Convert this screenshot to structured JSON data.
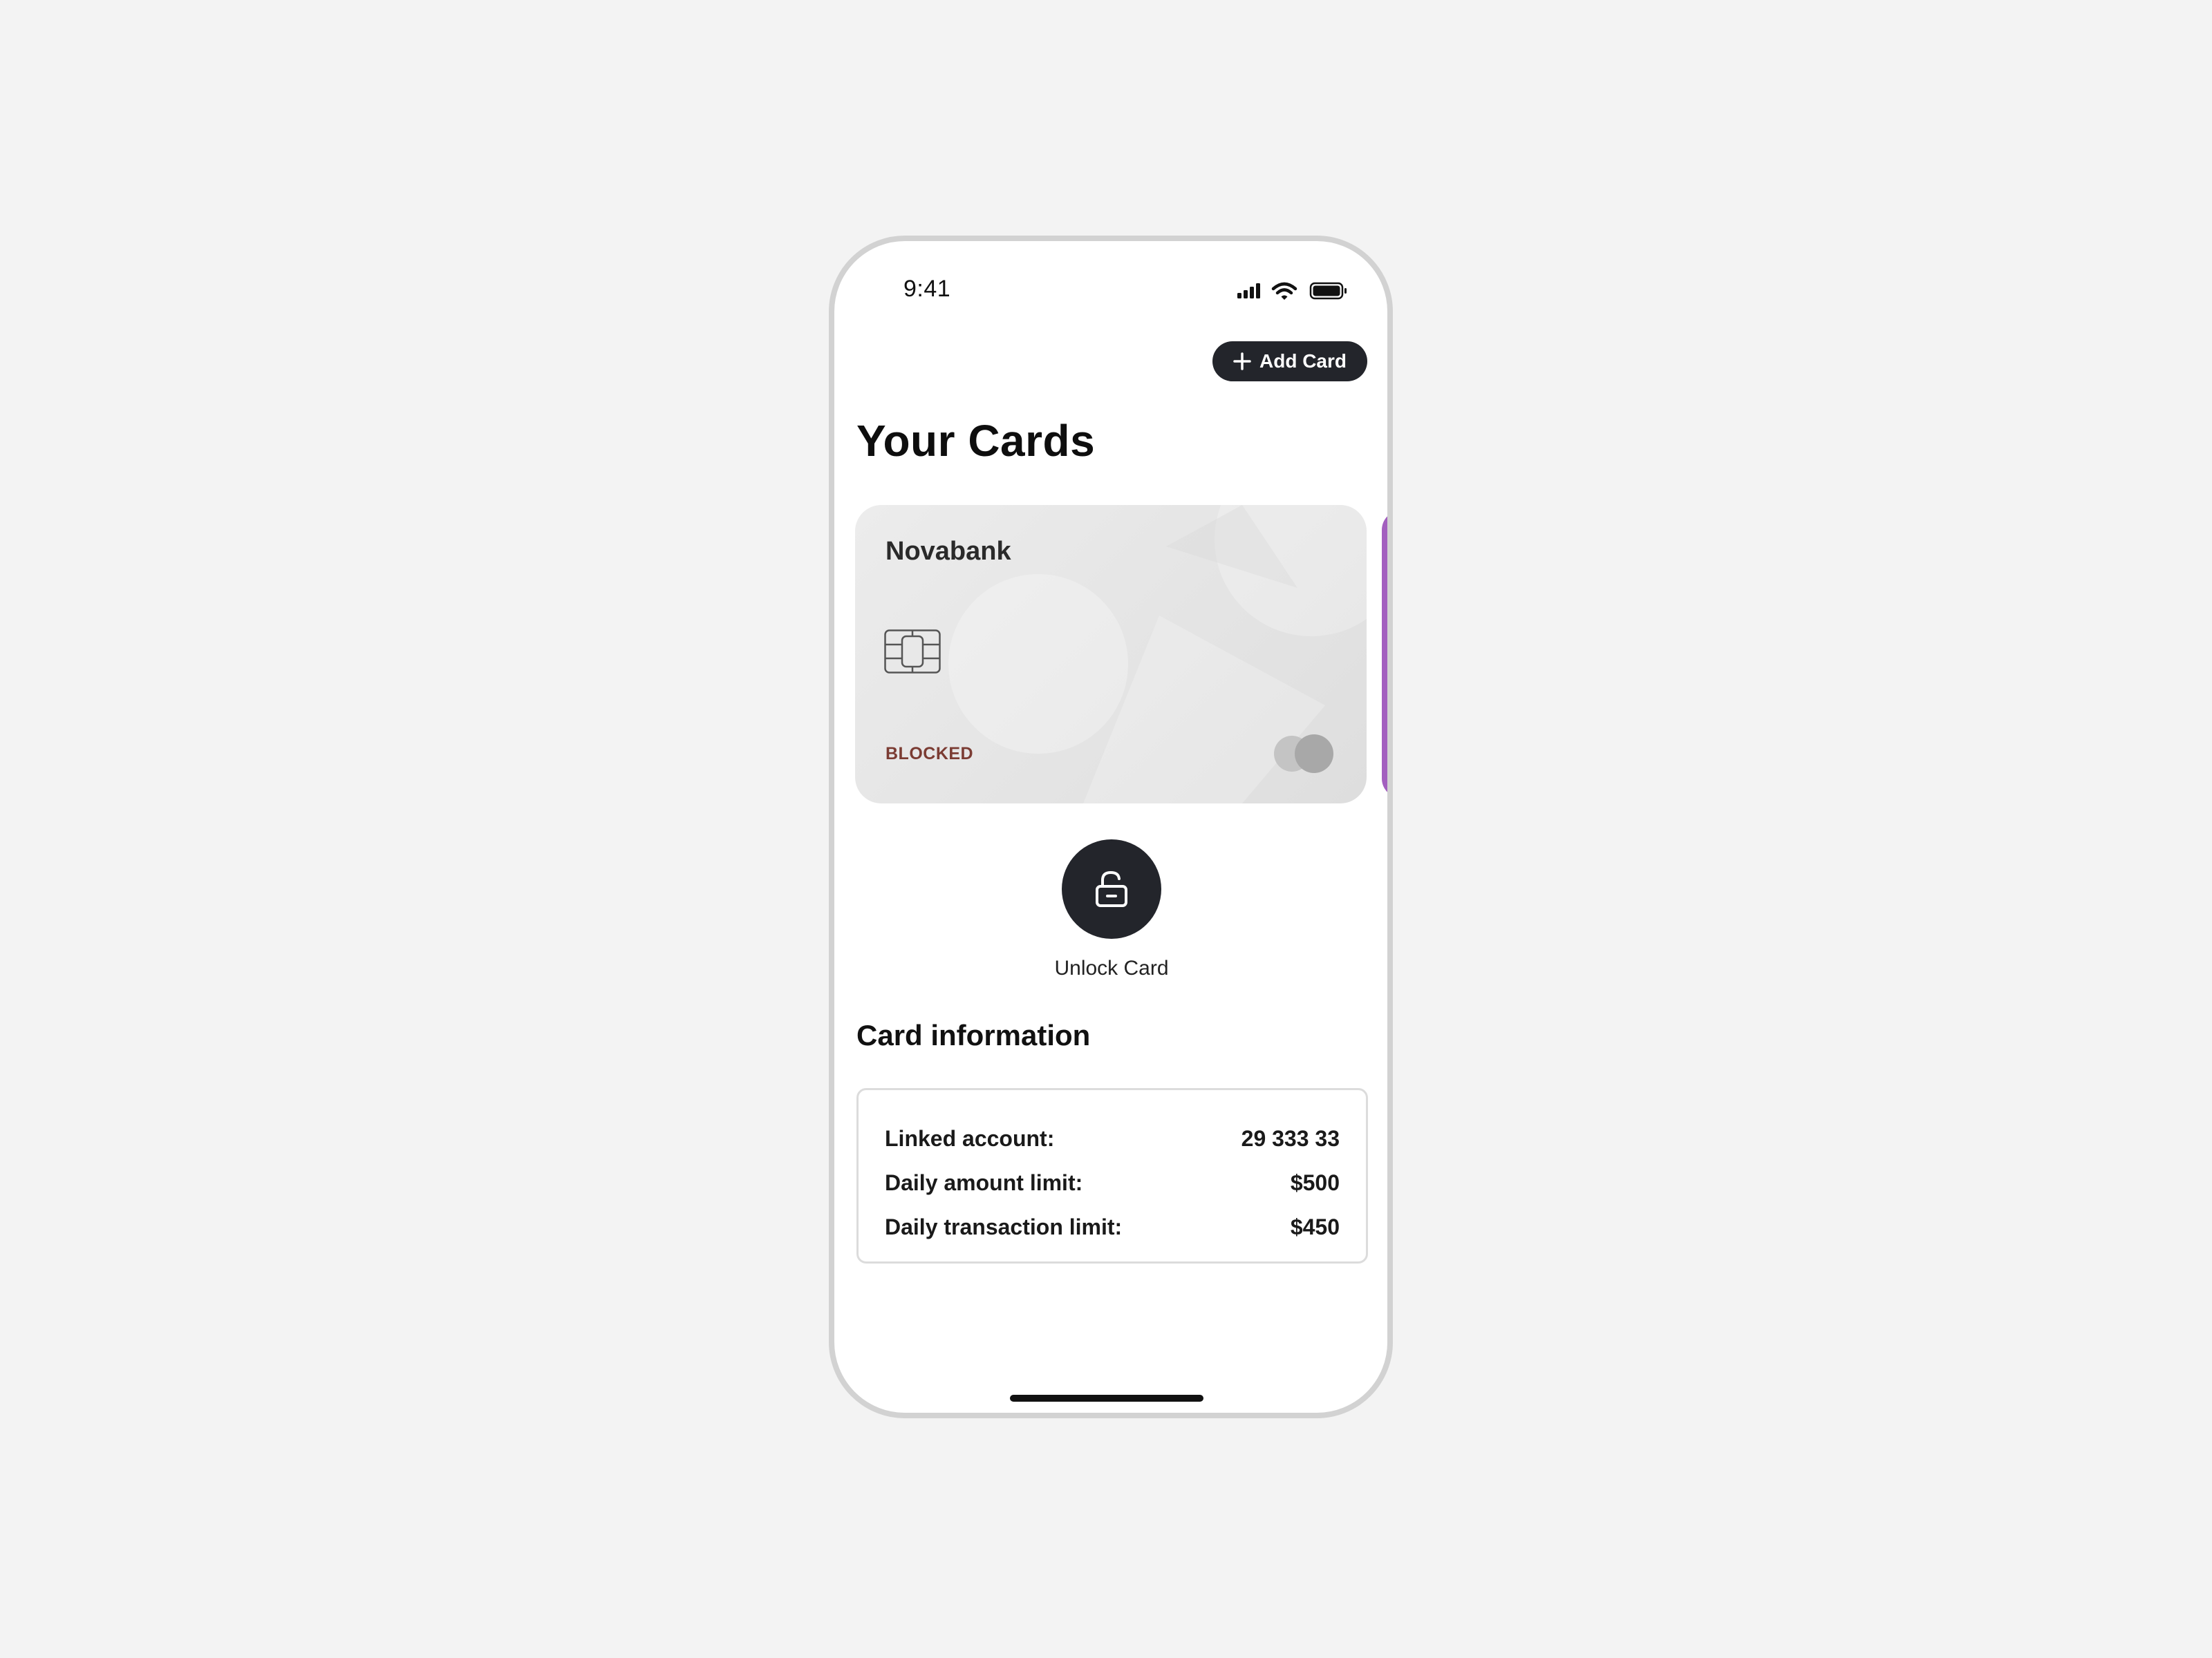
{
  "status_bar": {
    "time": "9:41",
    "icons": [
      "signal-icon",
      "wifi-icon",
      "battery-icon"
    ]
  },
  "header": {
    "add_card_label": "Add Card",
    "add_card_icon": "plus-icon",
    "title": "Your Cards"
  },
  "card": {
    "bank_name": "Novabank",
    "status": "BLOCKED",
    "chip_icon": "chip-icon",
    "network_icon": "card-network-logo",
    "colors": {
      "background": "#e4e4e4",
      "status_text": "#7b3c33",
      "next_card_peek": "#a35fbf"
    }
  },
  "actions": {
    "unlock_label": "Unlock Card",
    "unlock_icon": "unlock-icon"
  },
  "card_information": {
    "title": "Card information",
    "rows": [
      {
        "label": "Linked account:",
        "value": "29 333 33"
      },
      {
        "label": "Daily amount limit:",
        "value": "$500"
      },
      {
        "label": "Daily transaction limit:",
        "value": "$450"
      }
    ]
  },
  "colors": {
    "accent_dark": "#23252b",
    "page_background": "#f3f3f3",
    "phone_frame": "#d2d2d2"
  }
}
